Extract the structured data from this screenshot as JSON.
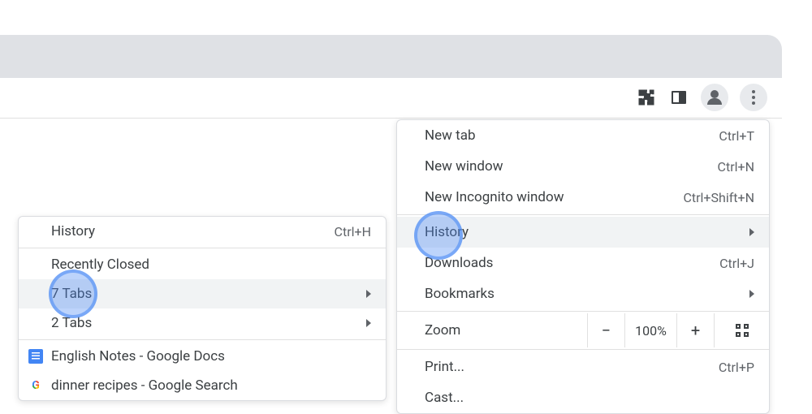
{
  "toolbar": {
    "extensions_icon": "extensions-icon",
    "side_panel_icon": "side-panel-icon",
    "profile_icon": "profile-icon",
    "menu_icon": "more-menu-icon"
  },
  "menu": {
    "new_tab": {
      "label": "New tab",
      "shortcut": "Ctrl+T"
    },
    "new_window": {
      "label": "New window",
      "shortcut": "Ctrl+N"
    },
    "incognito": {
      "label": "New Incognito window",
      "shortcut": "Ctrl+Shift+N"
    },
    "history": {
      "label": "History"
    },
    "downloads": {
      "label": "Downloads",
      "shortcut": "Ctrl+J"
    },
    "bookmarks": {
      "label": "Bookmarks"
    },
    "zoom": {
      "label": "Zoom",
      "value": "100%"
    },
    "print": {
      "label": "Print...",
      "shortcut": "Ctrl+P"
    },
    "cast": {
      "label": "Cast..."
    }
  },
  "submenu": {
    "history": {
      "label": "History",
      "shortcut": "Ctrl+H"
    },
    "recently_closed": {
      "label": "Recently Closed"
    },
    "tabs_a": {
      "label": "7 Tabs"
    },
    "tabs_b": {
      "label": "2 Tabs"
    },
    "item_docs": {
      "label": "English Notes - Google Docs"
    },
    "item_search": {
      "label": "dinner recipes - Google Search"
    }
  }
}
